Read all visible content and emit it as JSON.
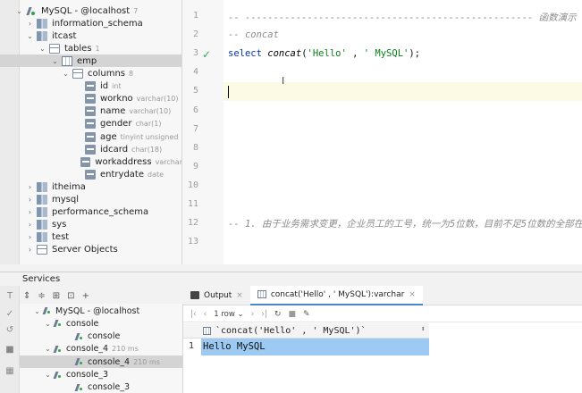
{
  "db_tree": [
    {
      "label": "MySQL - @localhost",
      "meta": "7",
      "icon": "connection-icon",
      "expanded": true
    },
    {
      "label": "information_schema",
      "meta": "",
      "icon": "schema-icon",
      "expanded": false
    },
    {
      "label": "itcast",
      "meta": "",
      "icon": "schema-icon",
      "expanded": true
    },
    {
      "label": "tables",
      "meta": "1",
      "icon": "folder-icon",
      "expanded": true
    },
    {
      "label": "emp",
      "meta": "",
      "icon": "table-icon",
      "expanded": true,
      "selected": true
    },
    {
      "label": "columns",
      "meta": "8",
      "icon": "folder-icon",
      "expanded": true
    },
    {
      "label": "id",
      "meta": "int",
      "icon": "column-icon"
    },
    {
      "label": "workno",
      "meta": "varchar(10)",
      "icon": "column-icon"
    },
    {
      "label": "name",
      "meta": "varchar(10)",
      "icon": "column-icon"
    },
    {
      "label": "gender",
      "meta": "char(1)",
      "icon": "column-icon"
    },
    {
      "label": "age",
      "meta": "tinyint unsigned",
      "icon": "column-icon"
    },
    {
      "label": "idcard",
      "meta": "char(18)",
      "icon": "column-icon"
    },
    {
      "label": "workaddress",
      "meta": "varchar",
      "icon": "column-icon"
    },
    {
      "label": "entrydate",
      "meta": "date",
      "icon": "column-icon"
    },
    {
      "label": "itheima",
      "meta": "",
      "icon": "schema-icon",
      "expanded": false
    },
    {
      "label": "mysql",
      "meta": "",
      "icon": "schema-icon",
      "expanded": false
    },
    {
      "label": "performance_schema",
      "meta": "",
      "icon": "schema-icon",
      "expanded": false
    },
    {
      "label": "sys",
      "meta": "",
      "icon": "schema-icon",
      "expanded": false
    },
    {
      "label": "test",
      "meta": "",
      "icon": "schema-icon",
      "expanded": false
    },
    {
      "label": "Server Objects",
      "meta": "",
      "icon": "folder-icon",
      "expanded": false
    }
  ],
  "editor": {
    "line_numbers": [
      "1",
      "2",
      "3",
      "4",
      "5",
      "6",
      "7",
      "8",
      "9",
      "10",
      "11",
      "12",
      "13"
    ],
    "line1": "-- --------------------------------------------------- 函数演示",
    "line2": "-- concat",
    "line3": {
      "kw": "select ",
      "fn": "concat",
      "open": "(",
      "s1": "'Hello'",
      "sep": " , ",
      "s2": "' MySQL'",
      "close": ");"
    },
    "line12": "-- 1. 由于业务需求变更，企业员工的工号，统一为5位数，目前不足5位数的全部在前"
  },
  "services": {
    "title": "Services",
    "tree": [
      {
        "label": "MySQL - @localhost",
        "meta": ""
      },
      {
        "label": "console",
        "meta": ""
      },
      {
        "label": "console",
        "meta": ""
      },
      {
        "label": "console_4",
        "meta": "210 ms"
      },
      {
        "label": "console_4",
        "meta": "210 ms",
        "selected": true
      },
      {
        "label": "console_3",
        "meta": ""
      },
      {
        "label": "console_3",
        "meta": ""
      }
    ]
  },
  "results": {
    "tab_output": "Output",
    "tab_result": "concat('Hello' , ' MySQL'):varchar",
    "rows_label": "1 row",
    "column_header": "`concat('Hello' , ' MySQL')`",
    "row_number": "1",
    "cell_value": "Hello MySQL"
  },
  "colors": {
    "accent": "#4a86c8",
    "selection": "#9ccaf3",
    "success": "#38a852"
  }
}
